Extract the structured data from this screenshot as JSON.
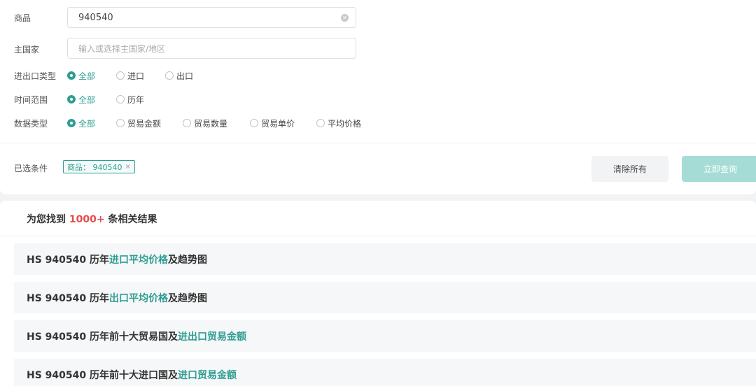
{
  "filters": {
    "product": {
      "label": "商品",
      "value": "940540"
    },
    "country": {
      "label": "主国家",
      "placeholder": "输入或选择主国家/地区"
    },
    "trade_type": {
      "label": "进出口类型",
      "options": [
        "全部",
        "进口",
        "出口"
      ],
      "selected": 0
    },
    "time_range": {
      "label": "时间范围",
      "options": [
        "全部",
        "历年"
      ],
      "selected": 0
    },
    "data_type": {
      "label": "数据类型",
      "options": [
        "全部",
        "贸易金额",
        "贸易数量",
        "贸易单价",
        "平均价格"
      ],
      "selected": 0
    }
  },
  "selected": {
    "label": "已选条件",
    "tag_text": "商品： 940540",
    "tag_close": "×"
  },
  "buttons": {
    "clear": "清除所有",
    "query": "立即查询"
  },
  "results": {
    "prefix": "为您找到 ",
    "count": "1000+",
    "suffix": " 条相关结果",
    "items": [
      {
        "pre": "HS 940540 历年",
        "hl": "进口平均价格",
        "post": "及趋势图"
      },
      {
        "pre": "HS 940540 历年",
        "hl": "出口平均价格",
        "post": "及趋势图"
      },
      {
        "pre": "HS 940540 历年前十大贸易国及",
        "hl": "进出口贸易金额",
        "post": ""
      },
      {
        "pre": "HS 940540 历年前十大进口国及",
        "hl": "进口贸易金额",
        "post": ""
      }
    ]
  },
  "colors": {
    "accent": "#2f9e92",
    "count": "#e84a4a",
    "query_button": "#a6dcd6"
  }
}
